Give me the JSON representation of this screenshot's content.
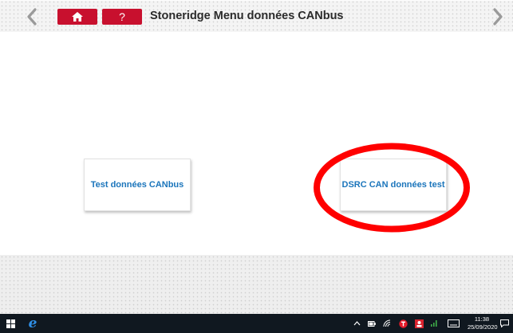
{
  "header": {
    "title": "Stoneridge Menu données CANbus",
    "home_icon": "home-icon",
    "help_label": "?",
    "back_icon": "chevron-left-icon",
    "forward_icon": "chevron-right-icon"
  },
  "colors": {
    "accent_red": "#c8102e",
    "tile_text_blue": "#1b75bb",
    "annotation_red": "#ff0000",
    "taskbar_bg": "#101820"
  },
  "tiles": [
    {
      "label": "Test données CANbus"
    },
    {
      "label": "DSRC CAN données test",
      "highlighted": true
    }
  ],
  "taskbar": {
    "time": "11:38",
    "date": "25/09/2020",
    "icons": [
      "windows-start-icon",
      "edge-browser-icon",
      "chevron-up-icon",
      "battery-icon",
      "wifi-icon",
      "app-red-t-icon",
      "app-red-person-icon",
      "network-icon",
      "keyboard-icon",
      "notification-icon"
    ]
  }
}
